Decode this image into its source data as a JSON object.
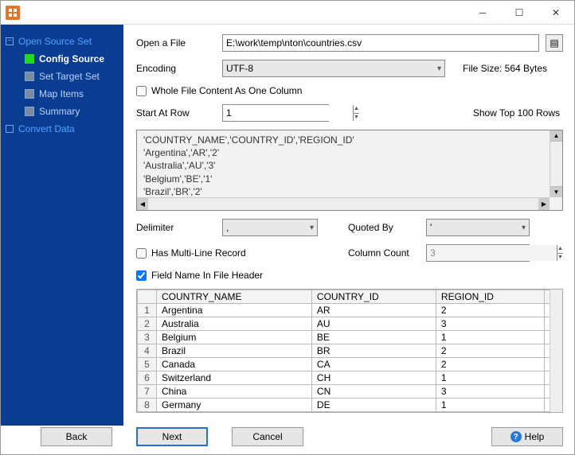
{
  "sidebar": {
    "top": "Open Source Set",
    "items": [
      "Config Source",
      "Set Target Set",
      "Map Items",
      "Summary"
    ],
    "active_index": 0,
    "bottom": "Convert Data"
  },
  "labels": {
    "open_file": "Open a File",
    "encoding": "Encoding",
    "file_size": "File Size: 564 Bytes",
    "whole_file": "Whole File Content As One Column",
    "start_row": "Start At Row",
    "show_top": "Show Top 100 Rows",
    "delimiter": "Delimiter",
    "quoted_by": "Quoted By",
    "multi_line": "Has Multi-Line Record",
    "col_count": "Column Count",
    "field_header": "Field Name In File Header"
  },
  "values": {
    "file_path": "E:\\work\\temp\\nton\\countries.csv",
    "encoding": "UTF-8",
    "start_row": "1",
    "delimiter": ",",
    "quoted_by": "'",
    "col_count": "3",
    "whole_file_checked": false,
    "multi_line_checked": false,
    "field_header_checked": true
  },
  "preview_lines": [
    "'COUNTRY_NAME','COUNTRY_ID','REGION_ID'",
    "'Argentina','AR','2'",
    "'Australia','AU','3'",
    "'Belgium','BE','1'",
    "'Brazil','BR','2'"
  ],
  "table": {
    "headers": [
      "COUNTRY_NAME",
      "COUNTRY_ID",
      "REGION_ID"
    ],
    "rows": [
      [
        "Argentina",
        "AR",
        "2"
      ],
      [
        "Australia",
        "AU",
        "3"
      ],
      [
        "Belgium",
        "BE",
        "1"
      ],
      [
        "Brazil",
        "BR",
        "2"
      ],
      [
        "Canada",
        "CA",
        "2"
      ],
      [
        "Switzerland",
        "CH",
        "1"
      ],
      [
        "China",
        "CN",
        "3"
      ],
      [
        "Germany",
        "DE",
        "1"
      ]
    ]
  },
  "footer": {
    "back": "Back",
    "next": "Next",
    "cancel": "Cancel",
    "help": "Help"
  }
}
